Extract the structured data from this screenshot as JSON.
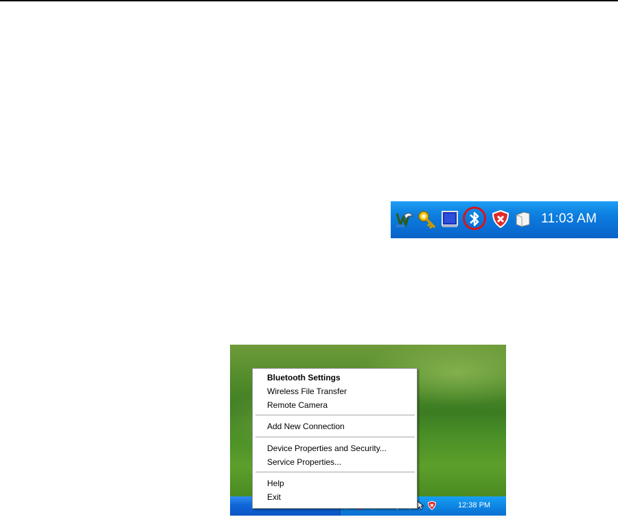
{
  "tray_closeup": {
    "clock": "11:03 AM",
    "icons": [
      "network-wizard-icon",
      "key-icon",
      "monitor-icon",
      "bluetooth-icon",
      "security-shield-icon",
      "folder-icon"
    ],
    "highlight_color": "#d9141b"
  },
  "desktop_shot": {
    "context_menu": {
      "items": [
        {
          "label": "Bluetooth Settings",
          "bold": true
        },
        {
          "label": "Wireless File Transfer"
        },
        {
          "label": "Remote Camera"
        },
        {
          "label": "Add New Connection"
        },
        {
          "label": "Device Properties and Security..."
        },
        {
          "label": "Service Properties..."
        },
        {
          "label": "Help"
        },
        {
          "label": "Exit"
        }
      ]
    },
    "taskbar": {
      "clock": "12:38 PM"
    }
  }
}
